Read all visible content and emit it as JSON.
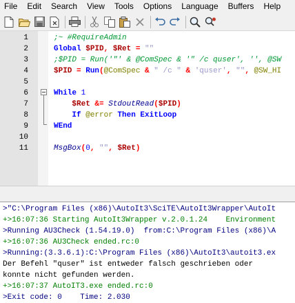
{
  "menu": [
    "File",
    "Edit",
    "Search",
    "View",
    "Tools",
    "Options",
    "Language",
    "Buffers",
    "Help"
  ],
  "toolbar_icons": [
    "new-file-icon",
    "open-folder-icon",
    "save-icon",
    "close-file-icon",
    "print-icon",
    "cut-icon",
    "copy-icon",
    "paste-icon",
    "delete-icon",
    "undo-icon",
    "redo-icon",
    "find-icon",
    "replace-icon"
  ],
  "editor": {
    "lines": [
      {
        "num": "1",
        "tokens": [
          {
            "t": ";~ #RequireAdmin",
            "c": "c-comment"
          }
        ]
      },
      {
        "num": "2",
        "tokens": [
          {
            "t": "Global ",
            "c": "c-kw"
          },
          {
            "t": "$PID",
            "c": "c-var"
          },
          {
            "t": ", ",
            "c": "c-op"
          },
          {
            "t": "$Ret",
            "c": "c-var"
          },
          {
            "t": " = ",
            "c": "c-op"
          },
          {
            "t": "\"\"",
            "c": "c-str"
          }
        ]
      },
      {
        "num": "3",
        "tokens": [
          {
            "t": ";$PID = Run('\"' & @ComSpec & '\" /c quser', '', @SW",
            "c": "c-comment"
          }
        ]
      },
      {
        "num": "4",
        "tokens": [
          {
            "t": "$PID",
            "c": "c-var"
          },
          {
            "t": " = ",
            "c": "c-op"
          },
          {
            "t": "Run",
            "c": "c-kw"
          },
          {
            "t": "(",
            "c": "c-op"
          },
          {
            "t": "@ComSpec",
            "c": "c-macro"
          },
          {
            "t": " & ",
            "c": "c-op"
          },
          {
            "t": "\" /c \"",
            "c": "c-str"
          },
          {
            "t": " & ",
            "c": "c-op"
          },
          {
            "t": "'quser'",
            "c": "c-str"
          },
          {
            "t": ", ",
            "c": "c-op"
          },
          {
            "t": "\"\"",
            "c": "c-str"
          },
          {
            "t": ", ",
            "c": "c-op"
          },
          {
            "t": "@SW_HI",
            "c": "c-macro"
          }
        ]
      },
      {
        "num": "5",
        "tokens": []
      },
      {
        "num": "6",
        "tokens": [
          {
            "t": "While ",
            "c": "c-kw"
          },
          {
            "t": "1",
            "c": "c-num"
          }
        ]
      },
      {
        "num": "7",
        "tokens": [
          {
            "t": "    ",
            "c": "c-id"
          },
          {
            "t": "$Ret",
            "c": "c-var"
          },
          {
            "t": " &= ",
            "c": "c-op"
          },
          {
            "t": "StdoutRead",
            "c": "c-func"
          },
          {
            "t": "(",
            "c": "c-op"
          },
          {
            "t": "$PID",
            "c": "c-var"
          },
          {
            "t": ")",
            "c": "c-op"
          }
        ]
      },
      {
        "num": "8",
        "tokens": [
          {
            "t": "    ",
            "c": "c-id"
          },
          {
            "t": "If ",
            "c": "c-kw"
          },
          {
            "t": "@error",
            "c": "c-macro"
          },
          {
            "t": " Then ExitLoop",
            "c": "c-kw"
          }
        ]
      },
      {
        "num": "9",
        "tokens": [
          {
            "t": "WEnd",
            "c": "c-kw"
          }
        ]
      },
      {
        "num": "10",
        "tokens": []
      },
      {
        "num": "11",
        "tokens": [
          {
            "t": "MsgBox",
            "c": "c-func"
          },
          {
            "t": "(",
            "c": "c-op"
          },
          {
            "t": "0",
            "c": "c-num"
          },
          {
            "t": ", ",
            "c": "c-op"
          },
          {
            "t": "\"\"",
            "c": "c-str"
          },
          {
            "t": ", ",
            "c": "c-op"
          },
          {
            "t": "$Ret",
            "c": "c-var"
          },
          {
            "t": ")",
            "c": "c-op"
          }
        ]
      }
    ]
  },
  "output": {
    "lines": [
      {
        "text": ">\"C:\\Program Files (x86)\\AutoIt3\\SciTE\\AutoIt3Wrapper\\AutoIt",
        "c": "o-blue"
      },
      {
        "text": "+>16:07:36 Starting AutoIt3Wrapper v.2.0.1.24    Environment",
        "c": "o-green"
      },
      {
        "text": ">Running AU3Check (1.54.19.0)  from:C:\\Program Files (x86)\\A",
        "c": "o-blue"
      },
      {
        "text": "+>16:07:36 AU3Check ended.rc:0",
        "c": "o-green"
      },
      {
        "text": ">Running:(3.3.6.1):C:\\Program Files (x86)\\AutoIt3\\autoit3.ex",
        "c": "o-blue"
      },
      {
        "text": "Der Befehl \"quser\" ist entweder falsch geschrieben oder",
        "c": "o-black"
      },
      {
        "text": "konnte nicht gefunden werden.",
        "c": "o-black"
      },
      {
        "text": "+>16:07:37 AutoIT3.exe ended.rc:0",
        "c": "o-green"
      },
      {
        "text": ">Exit code: 0    Time: 2.030",
        "c": "o-blue"
      }
    ]
  }
}
